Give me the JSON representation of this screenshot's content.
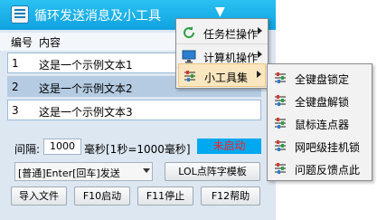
{
  "window": {
    "title": "循环发送消息及小工具",
    "colors": {
      "titlebar": "#13a8e6",
      "selected_row": "#b4cbe2",
      "status_bg": "#00a8f0",
      "status_text": "#ff2020"
    },
    "icons": [
      "app-list-icon",
      "menu-dropdown-icon",
      "minimize-icon",
      "close-icon"
    ]
  },
  "list": {
    "headers": [
      "编号",
      "内容"
    ],
    "rows": [
      {
        "num": "1",
        "text": "这是一个示例文本1"
      },
      {
        "num": "2",
        "text": "这是一个示例文本2"
      },
      {
        "num": "3",
        "text": "这是一个示例文本3"
      }
    ],
    "selected_row": 2
  },
  "controls": {
    "interval_label": "间隔:",
    "interval_value": "1000",
    "interval_unit": "毫秒[1秒=1000毫秒]",
    "status": "未启动",
    "send_mode": "[普通]Enter[回车]发送",
    "lol_button": "LOL点阵字模板",
    "import_button": "导入文件",
    "start_button": "F10启动",
    "stop_button": "F11停止",
    "help_button": "F12帮助"
  },
  "menu": {
    "items": [
      {
        "label": "任务栏操作",
        "icon": "refresh-icon"
      },
      {
        "label": "计算机操作",
        "icon": "computer-icon"
      },
      {
        "label": "小工具集",
        "icon": "sliders-icon"
      }
    ],
    "submenu": [
      {
        "label": "全键盘锁定",
        "icon": "sliders-icon"
      },
      {
        "label": "全键盘解锁",
        "icon": "sliders-icon"
      },
      {
        "label": "鼠标连点器",
        "icon": "sliders-icon"
      },
      {
        "label": "网吧级挂机锁",
        "icon": "sliders-icon"
      },
      {
        "label": "问题反馈点此",
        "icon": "sliders-icon"
      }
    ]
  }
}
